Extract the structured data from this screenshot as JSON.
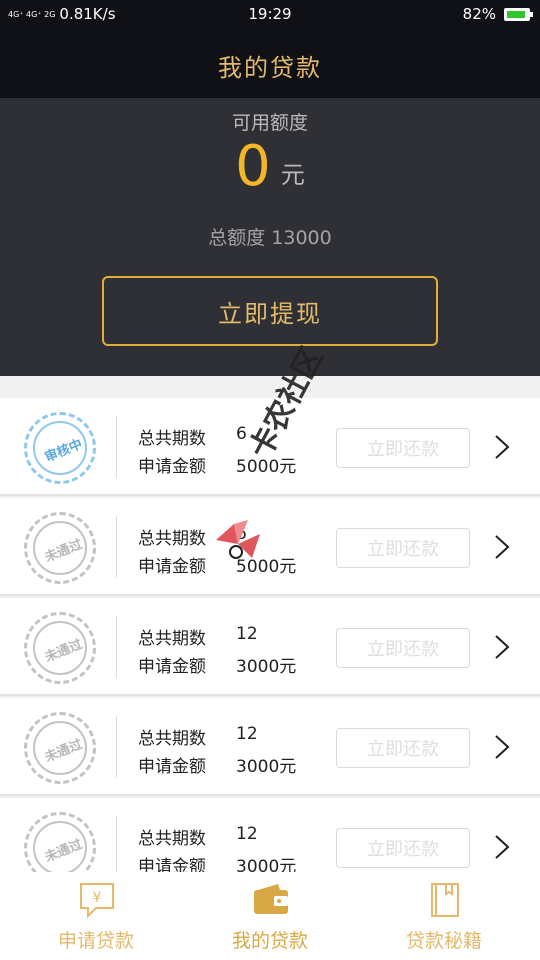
{
  "status_bar": {
    "signal": "4G⁺ 4G⁺ 2G",
    "speed": "0.81K/s",
    "time": "19:29",
    "battery_pct": "82%",
    "battery_level": 0.82
  },
  "nav": {
    "title": "我的贷款"
  },
  "summary": {
    "available_label": "可用额度",
    "available_amount": "0",
    "unit": "元",
    "total_label": "总额度 13000",
    "withdraw_label": "立即提现"
  },
  "loans": [
    {
      "stamp": "审核中",
      "stamp_color": "#5aa7dd",
      "periods_label": "总共期数",
      "periods": "6",
      "amount_label": "申请金额",
      "amount": "5000元",
      "repay_label": "立即还款"
    },
    {
      "stamp": "未通过",
      "stamp_color": "#b8b8b8",
      "periods_label": "总共期数",
      "periods": "6",
      "amount_label": "申请金额",
      "amount": "5000元",
      "repay_label": "立即还款"
    },
    {
      "stamp": "未通过",
      "stamp_color": "#b8b8b8",
      "periods_label": "总共期数",
      "periods": "12",
      "amount_label": "申请金额",
      "amount": "3000元",
      "repay_label": "立即还款"
    },
    {
      "stamp": "未通过",
      "stamp_color": "#b8b8b8",
      "periods_label": "总共期数",
      "periods": "12",
      "amount_label": "申请金额",
      "amount": "3000元",
      "repay_label": "立即还款"
    },
    {
      "stamp": "未通过",
      "stamp_color": "#b8b8b8",
      "periods_label": "总共期数",
      "periods": "12",
      "amount_label": "申请金额",
      "amount": "3000元",
      "repay_label": "立即还款"
    }
  ],
  "tabs": [
    {
      "label": "申请贷款",
      "icon": "apply-loan-icon"
    },
    {
      "label": "我的贷款",
      "icon": "wallet-icon",
      "active": true
    },
    {
      "label": "贷款秘籍",
      "icon": "book-icon"
    }
  ],
  "watermark": {
    "text": "卡农社区",
    "icon": "kanong-logo-icon"
  },
  "colors": {
    "accent": "#e4b96b",
    "amount": "#f3b726",
    "header_bg": "#0f1116",
    "summary_bg": "#2f3035"
  }
}
